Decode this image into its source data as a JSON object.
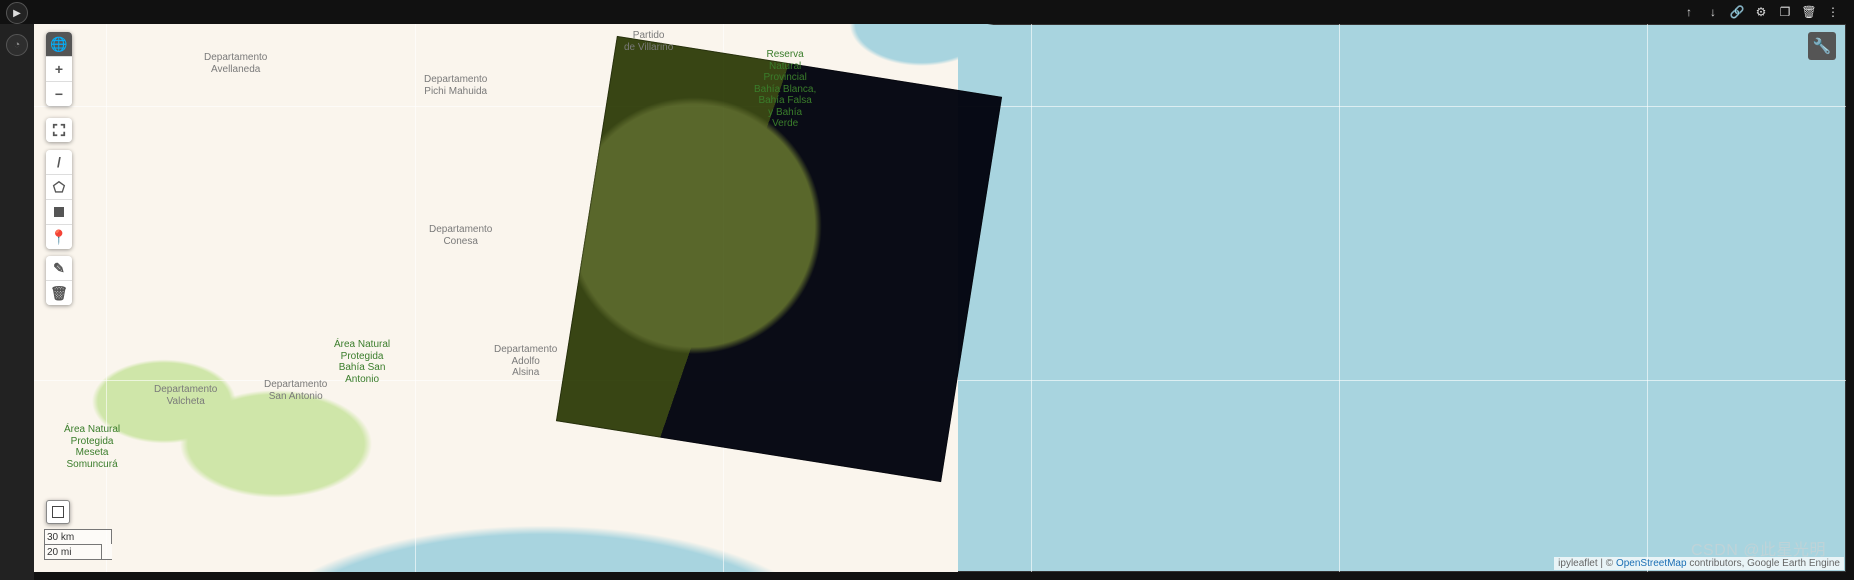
{
  "celltoolbar": {
    "move_up": "↑",
    "move_down": "↓",
    "link": "🔗",
    "settings": "⚙",
    "duplicate": "❐",
    "delete": "🗑",
    "more": "⋮"
  },
  "run_glyph": "▶",
  "gutter_glyph": "◔",
  "mapcontrols": {
    "globe": "🌐",
    "zoom_in": "+",
    "zoom_out": "−",
    "line": "/",
    "pentagon": "⬠",
    "marker": "📍",
    "edit": "✎",
    "trash": "🗑",
    "wrench": "🔧"
  },
  "labels": {
    "villarino": "Partido\nde Villarino",
    "avellaneda": "Departamento\nAvellaneda",
    "pichi": "Departamento\nPichi Mahuida",
    "conesa": "Departamento\nConesa",
    "adolfo": "Departamento\nAdolfo\nAlsina",
    "sanantonio": "Departamento\nSan Antonio",
    "valcheta": "Departamento\nValcheta",
    "area_bsa": "Área Natural\nProtegida\nBahía San\nAntonio",
    "area_meseta": "Área Natural\nProtegida\nMeseta\nSomuncurá",
    "reserva_bbbf": "Reserva\nNatural\nProvincial\nBahía Blanca,\nBahía Falsa\ny Bahía\nVerde"
  },
  "scale": {
    "km": "30 km",
    "mi": "20 mi"
  },
  "attribution": {
    "prefix": "ipyleaflet | © ",
    "osm": "OpenStreetMap",
    "suffix": " contributors, Google Earth Engine"
  },
  "watermark": "CSDN @此星光明"
}
